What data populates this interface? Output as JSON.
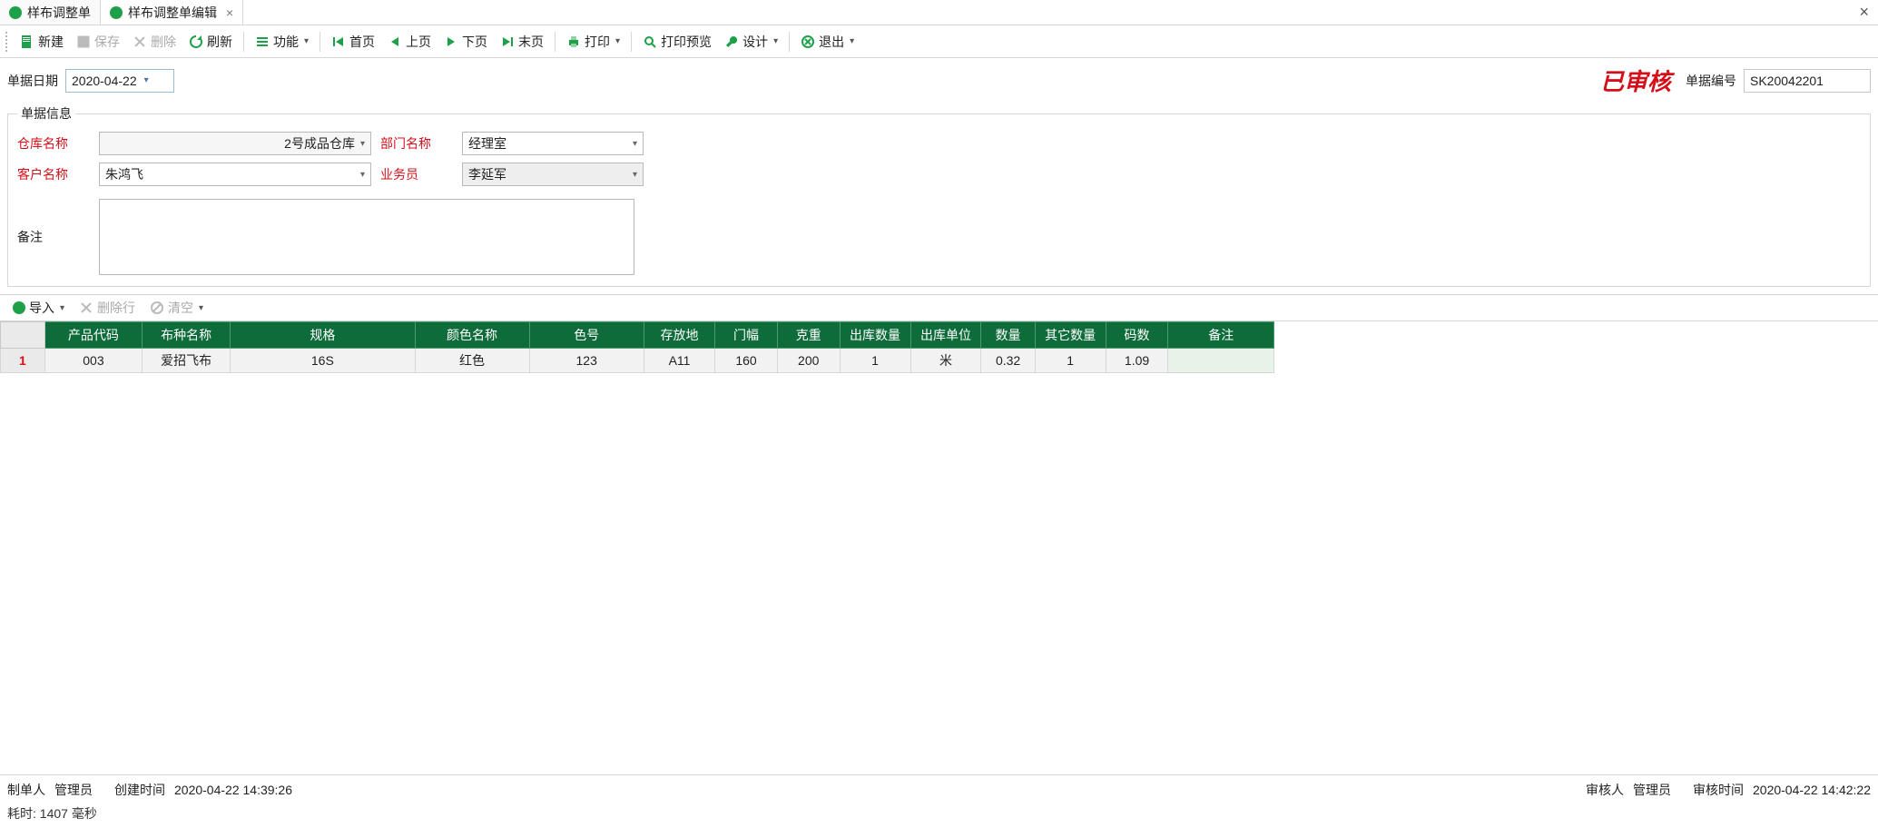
{
  "tabs": {
    "items": [
      {
        "label": "样布调整单"
      },
      {
        "label": "样布调整单编辑"
      }
    ],
    "active_index": 1
  },
  "toolbar": {
    "new": "新建",
    "save": "保存",
    "delete": "删除",
    "refresh": "刷新",
    "function": "功能",
    "first": "首页",
    "prev": "上页",
    "next": "下页",
    "last": "末页",
    "print": "打印",
    "preview": "打印预览",
    "design": "设计",
    "exit": "退出"
  },
  "header": {
    "date_label": "单据日期",
    "date_value": "2020-04-22",
    "status_stamp": "已审核",
    "docno_label": "单据编号",
    "docno_value": "SK20042201"
  },
  "fieldset": {
    "legend": "单据信息",
    "warehouse_label": "仓库名称",
    "warehouse_value": "2号成品仓库",
    "dept_label": "部门名称",
    "dept_value": "经理室",
    "customer_label": "客户名称",
    "customer_value": "朱鸿飞",
    "salesman_label": "业务员",
    "salesman_value": "李延军",
    "remark_label": "备注",
    "remark_value": ""
  },
  "subtoolbar": {
    "import": "导入",
    "delete_row": "删除行",
    "clear": "清空"
  },
  "table": {
    "columns": [
      "产品代码",
      "布种名称",
      "规格",
      "颜色名称",
      "色号",
      "存放地",
      "门幅",
      "克重",
      "出库数量",
      "出库单位",
      "数量",
      "其它数量",
      "码数",
      "备注"
    ],
    "rows": [
      {
        "idx": "1",
        "cells": [
          "003",
          "爱招飞布",
          "16S",
          "红色",
          "123",
          "A11",
          "160",
          "200",
          "1",
          "米",
          "0.32",
          "1",
          "1.09",
          ""
        ]
      }
    ]
  },
  "footer": {
    "maker_label": "制单人",
    "maker_value": "管理员",
    "create_time_label": "创建时间",
    "create_time_value": "2020-04-22 14:39:26",
    "auditor_label": "审核人",
    "auditor_value": "管理员",
    "audit_time_label": "审核时间",
    "audit_time_value": "2020-04-22 14:42:22",
    "elapsed": "耗时: 1407 毫秒"
  }
}
